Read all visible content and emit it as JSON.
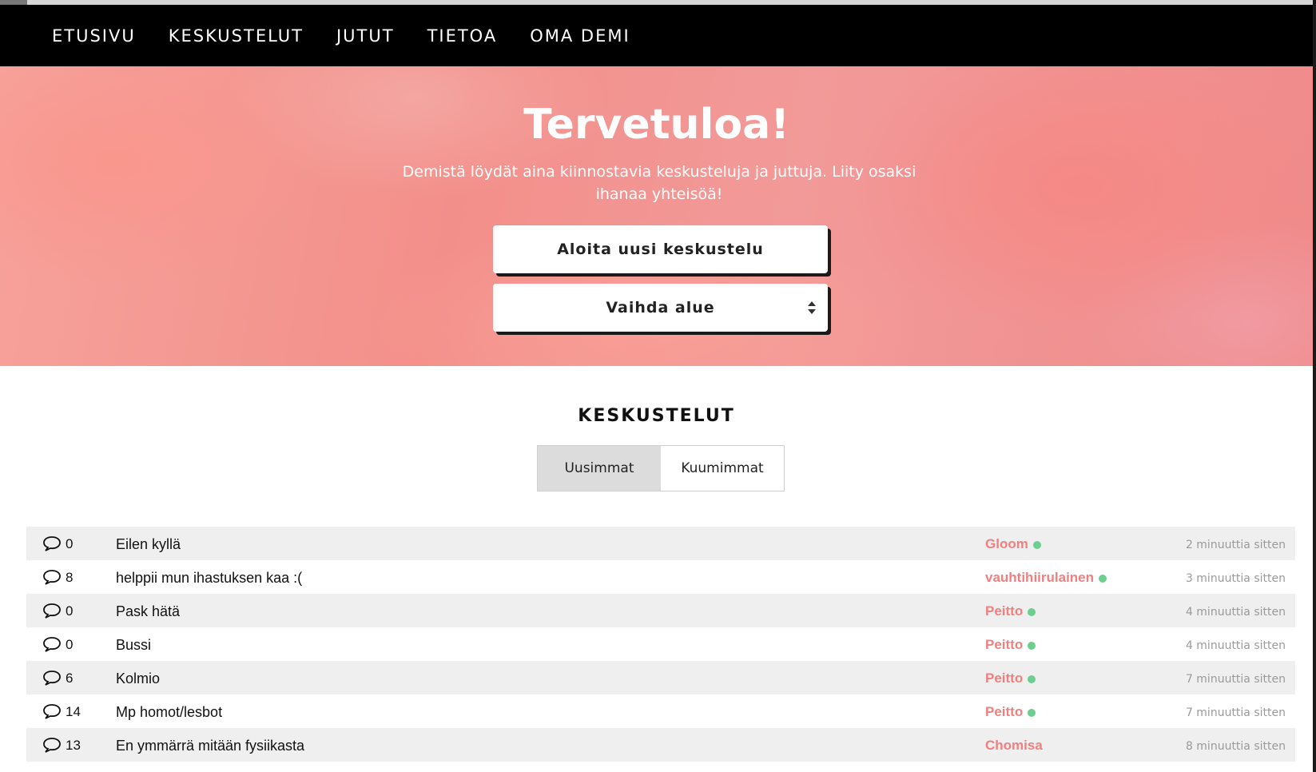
{
  "nav": {
    "items": [
      "ETUSIVU",
      "KESKUSTELUT",
      "JUTUT",
      "TIETOA",
      "OMA DEMI"
    ]
  },
  "hero": {
    "title": "Tervetuloa!",
    "subtitle": "Demistä löydät aina kiinnostavia keskusteluja ja juttuja. Liity osaksi ihanaa yhteisöä!",
    "new_thread_label": "Aloita uusi keskustelu",
    "area_select_label": "Vaihda alue"
  },
  "section": {
    "title": "KESKUSTELUT",
    "tabs": [
      "Uusimmat",
      "Kuumimmat"
    ],
    "active_tab": "Uusimmat"
  },
  "threads": [
    {
      "count": "0",
      "title": "Eilen kyllä",
      "user": "Gloom",
      "online": true,
      "time": "2 minuuttia sitten"
    },
    {
      "count": "8",
      "title": "helppii mun ihastuksen kaa :(",
      "user": "vauhtihiirulainen",
      "online": true,
      "time": "3 minuuttia sitten"
    },
    {
      "count": "0",
      "title": "Pask hätä",
      "user": "Peitto",
      "online": true,
      "time": "4 minuuttia sitten"
    },
    {
      "count": "0",
      "title": "Bussi",
      "user": "Peitto",
      "online": true,
      "time": "4 minuuttia sitten"
    },
    {
      "count": "6",
      "title": "Kolmio",
      "user": "Peitto",
      "online": true,
      "time": "7 minuuttia sitten"
    },
    {
      "count": "14",
      "title": "Mp homot/lesbot",
      "user": "Peitto",
      "online": true,
      "time": "7 minuuttia sitten"
    },
    {
      "count": "13",
      "title": "En ymmärrä mitään fysiikasta",
      "user": "Chomisa",
      "online": false,
      "time": "8 minuuttia sitten"
    }
  ],
  "colors": {
    "nav_bg": "#000000",
    "username": "#f08080",
    "online_dot": "#6ccf8f",
    "row_shade": "#efefef",
    "tab_active": "#dcdcdc"
  },
  "icons": {
    "thread_count": "speech-bubble-icon",
    "area_select": "sort-arrows-icon"
  }
}
